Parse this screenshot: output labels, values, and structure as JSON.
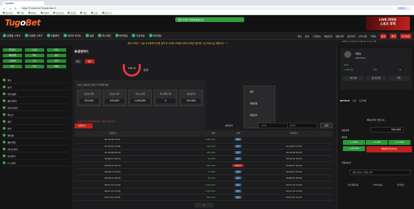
{
  "browser": {
    "tab_title": "TugoBet",
    "url": "tugo-79.com/mc/?single-tab=1",
    "update_label": "업데이트 ⋮",
    "bookmarks": [
      "웹사이트",
      "지메",
      "유튜브",
      "유튜버",
      "은행교계",
      "환전관",
      "에반",
      "교일",
      "바로가기"
    ]
  },
  "header": {
    "logo_part1": "Tug",
    "logo_o": "o",
    "logo_part2": "Bet",
    "toast": "충전 요청이 완료되었습니다.",
    "banner_line1": "LIVE 라이브",
    "banner_line2": "스포츠 후적"
  },
  "mainnav": {
    "items": [
      "유럽형 스포츠",
      "국내형 스포츠",
      "인플레이",
      "라이브 카지노",
      "슬롯",
      "미니게임",
      "토큰게임",
      "가상게임",
      "보관게임"
    ],
    "right_items": [
      "충전",
      "환전",
      "고객센터",
      "배팅규정",
      "배팅내역",
      "정지내역",
      "공지사항",
      "이벤트",
      "출석",
      "쪽지",
      "로그아웃"
    ]
  },
  "ticker": "접속 도메인 : 구글 주소창에 투고벳 입력 후 주세요 모바일 이제 주고에선 즐거운 시간 보내시길 바랍니다 ^^",
  "clock": "GMT+0 2024-10-08 10:47:01 PM",
  "sidebar": {
    "buttons": [
      "즐겨찾기",
      "스포츠",
      "카지노",
      "배팅내역",
      "쪽지",
      "충전",
      "고객센터",
      "출석",
      "환전",
      "환전",
      "입금",
      "이벤트"
    ],
    "items": [
      {
        "label": "축구",
        "count": ""
      },
      {
        "label": "농구",
        "count": ""
      },
      {
        "label": "야구/골프",
        "count": ""
      },
      {
        "label": "배구/하키",
        "count": ""
      },
      {
        "label": "아이스하키",
        "count": ""
      },
      {
        "label": "테니스",
        "count": ""
      },
      {
        "label": "배구",
        "count": ""
      },
      {
        "label": "탁구",
        "count": ""
      },
      {
        "label": "핸드볼",
        "count": ""
      },
      {
        "label": "배드민턴",
        "count": ""
      },
      {
        "label": "아이스하키",
        "count": ""
      },
      {
        "label": "미식축구",
        "count": ""
      },
      {
        "label": "E-스포츠",
        "count": ""
      }
    ]
  },
  "content": {
    "title": "충/환전하기",
    "tab_deposit": "충전",
    "tab_withdraw": "환전",
    "gauge_value": "100 %",
    "gauge_label": "완료",
    "info_title": "보너스 롤링조건 확인 후 진행하세요",
    "money_boxes": [
      {
        "label": "스포츠(단폴)",
        "value": "520,000"
      },
      {
        "label": "스포츠(다폴)",
        "value": "520,000"
      },
      {
        "label": "카지노/슬롯",
        "value": "1,000,000"
      },
      {
        "label": "미니게임/기타",
        "value": "0"
      },
      {
        "label": "보유포인트",
        "value": "520,000"
      }
    ],
    "info_note": "※ 롤링조건이 충족되어야 출금 신청이 가능합니다 ...",
    "dropdown": [
      "충전",
      "계정변경",
      "회원관리"
    ],
    "cancel_label": "요청취소",
    "filter_label": "날짜검색",
    "date_from": "시작일",
    "date_to": "종료일",
    "search_label": "검색",
    "pager": "1",
    "history_head": [
      "신청일시",
      "금액",
      "상태",
      "처리일시"
    ],
    "history_rows": [
      {
        "date": "24.10.08 16:07",
        "amount": "1,050,000",
        "status": "대기",
        "done": ""
      },
      {
        "date": "24.10.07 13:04",
        "amount": "150,000",
        "status": "승인",
        "done": "24.10.07 13:07"
      },
      {
        "date": "24.10.06 03:33",
        "amount": "180,000",
        "status": "승인",
        "done": "24.10.06 03:35"
      },
      {
        "date": "24.09.21 03:13",
        "amount": "50,000",
        "status": "승인",
        "done": "24.09.21 03:15"
      },
      {
        "date": "24.09.21 02:19",
        "amount": "200,000",
        "status": "처리취소",
        "done": "24.09.21 02:19"
      },
      {
        "date": "24.08.13 22:53",
        "amount": "10,000",
        "status": "승인",
        "done": "24.08.13 22:54"
      },
      {
        "date": "24.08.15 00:30",
        "amount": "50,000",
        "status": "승인",
        "done": "24.08.15 00:32"
      },
      {
        "date": "24.07.14 12:22",
        "amount": "1,000,000",
        "status": "승인",
        "done": "24.07.14 12:28"
      },
      {
        "date": "24.07.12 13:03",
        "amount": "1,000,000",
        "status": "승인",
        "done": "24.07.12 13:05"
      },
      {
        "date": "24.07.01 21:44",
        "amount": "500,000",
        "status": "승인",
        "done": "24.07.01 21:47"
      }
    ]
  },
  "right": {
    "name": "태블릿",
    "sub": "(tablet01)",
    "level": "Lv.1",
    "money": "4,580 원",
    "point": "0 P",
    "coupon": "0",
    "quick": [
      "머니전환",
      "포인트전환",
      "쿠폰"
    ],
    "betslip": "BETSLIP",
    "single": "싱글",
    "multi": "조합배팅",
    "empty": "배팅내역이 없습니다.",
    "bet_label": "배팅금액",
    "bet_amount": "500,000",
    "odds_label": "배당률",
    "win_label": "적중예상금",
    "presets": [
      "+1,000",
      "+5,000",
      "+10,000",
      "+50,000",
      "+100,000"
    ],
    "bet_btn": "배팅하기(MAX)",
    "odds_select": "배당 변경 시 자동 수락",
    "stats": [
      "미니게임모음",
      "바카라모음",
      "업데이트"
    ]
  },
  "colors": {
    "accent": "#c0211b",
    "green": "#2a9a3a",
    "logo": "#ff6a2b"
  }
}
